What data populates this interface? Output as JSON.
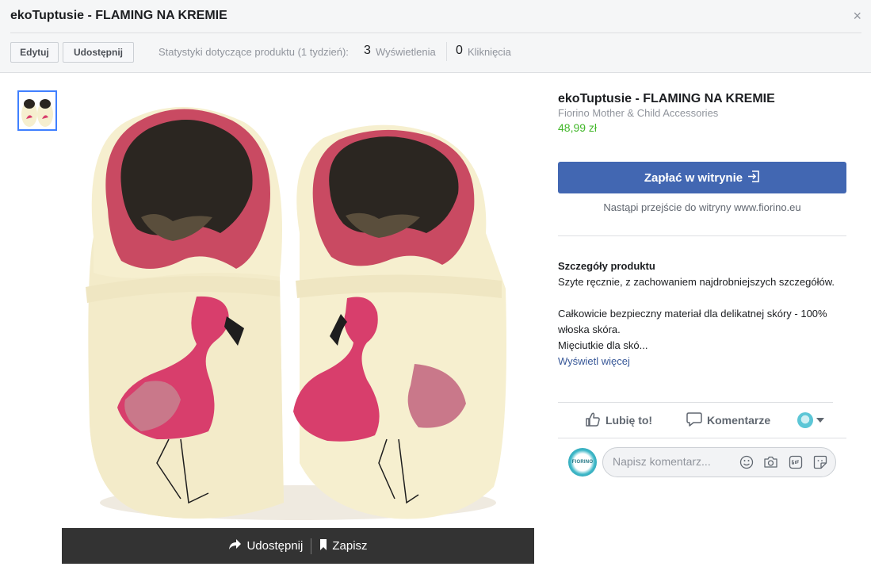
{
  "header": {
    "title": "ekoTuptusie - FLAMING NA KREMIE",
    "close_glyph": "×",
    "edit_label": "Edytuj",
    "share_label": "Udostępnij",
    "stats_label": "Statystyki dotyczące produktu (1 tydzień):",
    "views_count": "3",
    "views_label": "Wyświetlenia",
    "clicks_count": "0",
    "clicks_label": "Kliknięcia"
  },
  "photo_bar": {
    "share_label": "Udostępnij",
    "save_label": "Zapisz"
  },
  "product": {
    "name": "ekoTuptusie - FLAMING NA KREMIE",
    "seller": "Fiorino Mother & Child Accessories",
    "price": "48,99 zł",
    "pay_button": "Zapłać w witrynie",
    "redirect_note": "Nastąpi przejście do witryny www.fiorino.eu",
    "details_title": "Szczegóły produktu",
    "details_lines": [
      "Szyte ręcznie, z zachowaniem najdrobniejszych szczegółów.",
      "Całkowicie bezpieczny materiał dla delikatnej skóry - 100%",
      "włoska skóra.",
      "Mięciutkie dla skó..."
    ],
    "more_link": "Wyświetl więcej"
  },
  "actions": {
    "like_label": "Lubię to!",
    "comment_label": "Komentarze"
  },
  "comment": {
    "avatar_text": "FIORINO",
    "placeholder": "Napisz komentarz..."
  },
  "icons": {
    "close": "close-icon",
    "share": "share-arrow-icon",
    "save": "bookmark-icon",
    "external": "external-link-icon",
    "like": "thumbs-up-icon",
    "comment": "speech-bubble-icon",
    "emoji": "emoji-icon",
    "camera": "camera-icon",
    "gif": "gif-icon",
    "sticker": "sticker-icon"
  },
  "colors": {
    "accent": "#4267b2",
    "price": "#42b72a",
    "link": "#385898",
    "shoe_cream": "#f6efcf",
    "flamingo": "#d83e6c"
  }
}
